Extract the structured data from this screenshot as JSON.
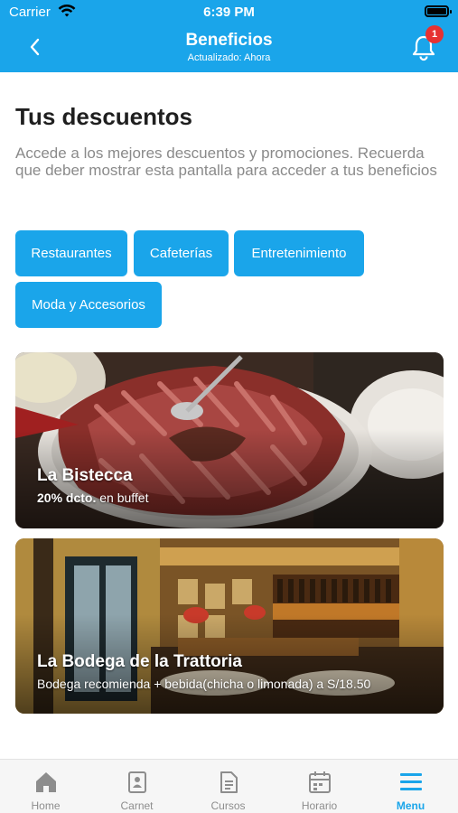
{
  "status_bar": {
    "carrier": "Carrier",
    "time": "6:39 PM"
  },
  "nav": {
    "title": "Beneficios",
    "subtitle": "Actualizado: Ahora",
    "notification_count": "1"
  },
  "main": {
    "heading": "Tus descuentos",
    "description": "Accede a los mejores descuentos y promociones. Recuerda que deber mostrar esta pantalla para acceder a tus beneficios",
    "categories": [
      {
        "label": "Restaurantes"
      },
      {
        "label": "Cafeterías"
      },
      {
        "label": "Entretenimiento"
      },
      {
        "label": "Moda y Accesorios"
      }
    ],
    "offers": [
      {
        "name": "La Bistecca",
        "deal_bold": "20% dcto.",
        "deal_rest": " en buffet"
      },
      {
        "name": "La Bodega de la Trattoria",
        "deal": "Bodega recomienda + bebida(chicha o limonada) a S/18.50"
      }
    ]
  },
  "tabbar": {
    "items": [
      {
        "label": "Home",
        "icon": "home-icon"
      },
      {
        "label": "Carnet",
        "icon": "id-card-icon"
      },
      {
        "label": "Cursos",
        "icon": "document-icon"
      },
      {
        "label": "Horario",
        "icon": "calendar-icon"
      },
      {
        "label": "Menu",
        "icon": "menu-icon",
        "active": true
      }
    ]
  },
  "colors": {
    "accent": "#1aa5ea",
    "badge": "#e63131"
  }
}
